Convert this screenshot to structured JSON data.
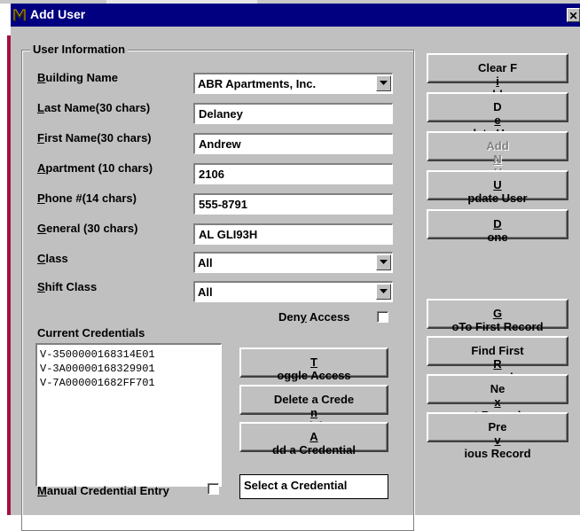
{
  "window": {
    "title": "Add User",
    "close_glyph": "✕",
    "icon": "app-logo-icon"
  },
  "group": {
    "legend": "User Information"
  },
  "fields": {
    "building_name": {
      "label_u": "B",
      "label_rest": "uilding Name",
      "value": "ABR Apartments, Inc."
    },
    "last_name": {
      "label_u": "L",
      "label_rest": "ast Name(30 chars)",
      "value": "Delaney"
    },
    "first_name": {
      "label_u": "F",
      "label_rest": "irst Name(30 chars)",
      "value": "Andrew"
    },
    "apartment": {
      "label_u": "A",
      "label_rest": "partment (10 chars)",
      "value": "2106"
    },
    "phone": {
      "label_u": "P",
      "label_rest": "hone #(14 chars)",
      "value": "555-8791"
    },
    "general": {
      "label_u": "G",
      "label_rest": "eneral (30 chars)",
      "value": "AL  GLI93H"
    },
    "class": {
      "label_u": "C",
      "label_rest": "lass",
      "value": "All"
    },
    "shift_class": {
      "label_u": "S",
      "label_rest": "hift Class",
      "value": "All"
    }
  },
  "deny_access": {
    "label_pre": "Den",
    "label_u": "y",
    "label_post": " Access",
    "checked": false
  },
  "credentials": {
    "label": "Current Credentials",
    "items": [
      "V-3500000168314E01",
      "V-3A00000168329901",
      "V-7A000001682FF701"
    ]
  },
  "credential_buttons": {
    "toggle": {
      "u": "T",
      "post": "oggle Access"
    },
    "delete": {
      "pre": "Delete a Crede",
      "u": "n",
      "post": "tial"
    },
    "add": {
      "u": "A",
      "post": "dd a Credential"
    }
  },
  "manual_entry": {
    "label_u": "M",
    "label_rest": "anual Credential Entry",
    "checked": false
  },
  "select_credential": "Select a Credential",
  "right_buttons": {
    "clear": {
      "pre": "Clear F",
      "u": "i",
      "post": "elds"
    },
    "delete": {
      "pre": "D",
      "u": "e",
      "post": "lete User"
    },
    "add_new": {
      "pre": "Add ",
      "u": "N",
      "post": "ew User",
      "disabled": true
    },
    "update": {
      "pre": "",
      "u": "U",
      "post": "pdate User"
    },
    "done": {
      "pre": "",
      "u": "D",
      "post": "one"
    },
    "goto_first": {
      "pre": "",
      "u": "G",
      "post": "oTo First Record"
    },
    "find_first": {
      "pre": "Find First ",
      "u": "R",
      "post": "ecord"
    },
    "next": {
      "pre": "Ne",
      "u": "x",
      "post": "t Record"
    },
    "previous": {
      "pre": "Pre",
      "u": "v",
      "post": "ious Record"
    }
  },
  "colors": {
    "titlebar": "#000080",
    "face": "#c0c0c0",
    "accent_bar": "#a41040"
  }
}
